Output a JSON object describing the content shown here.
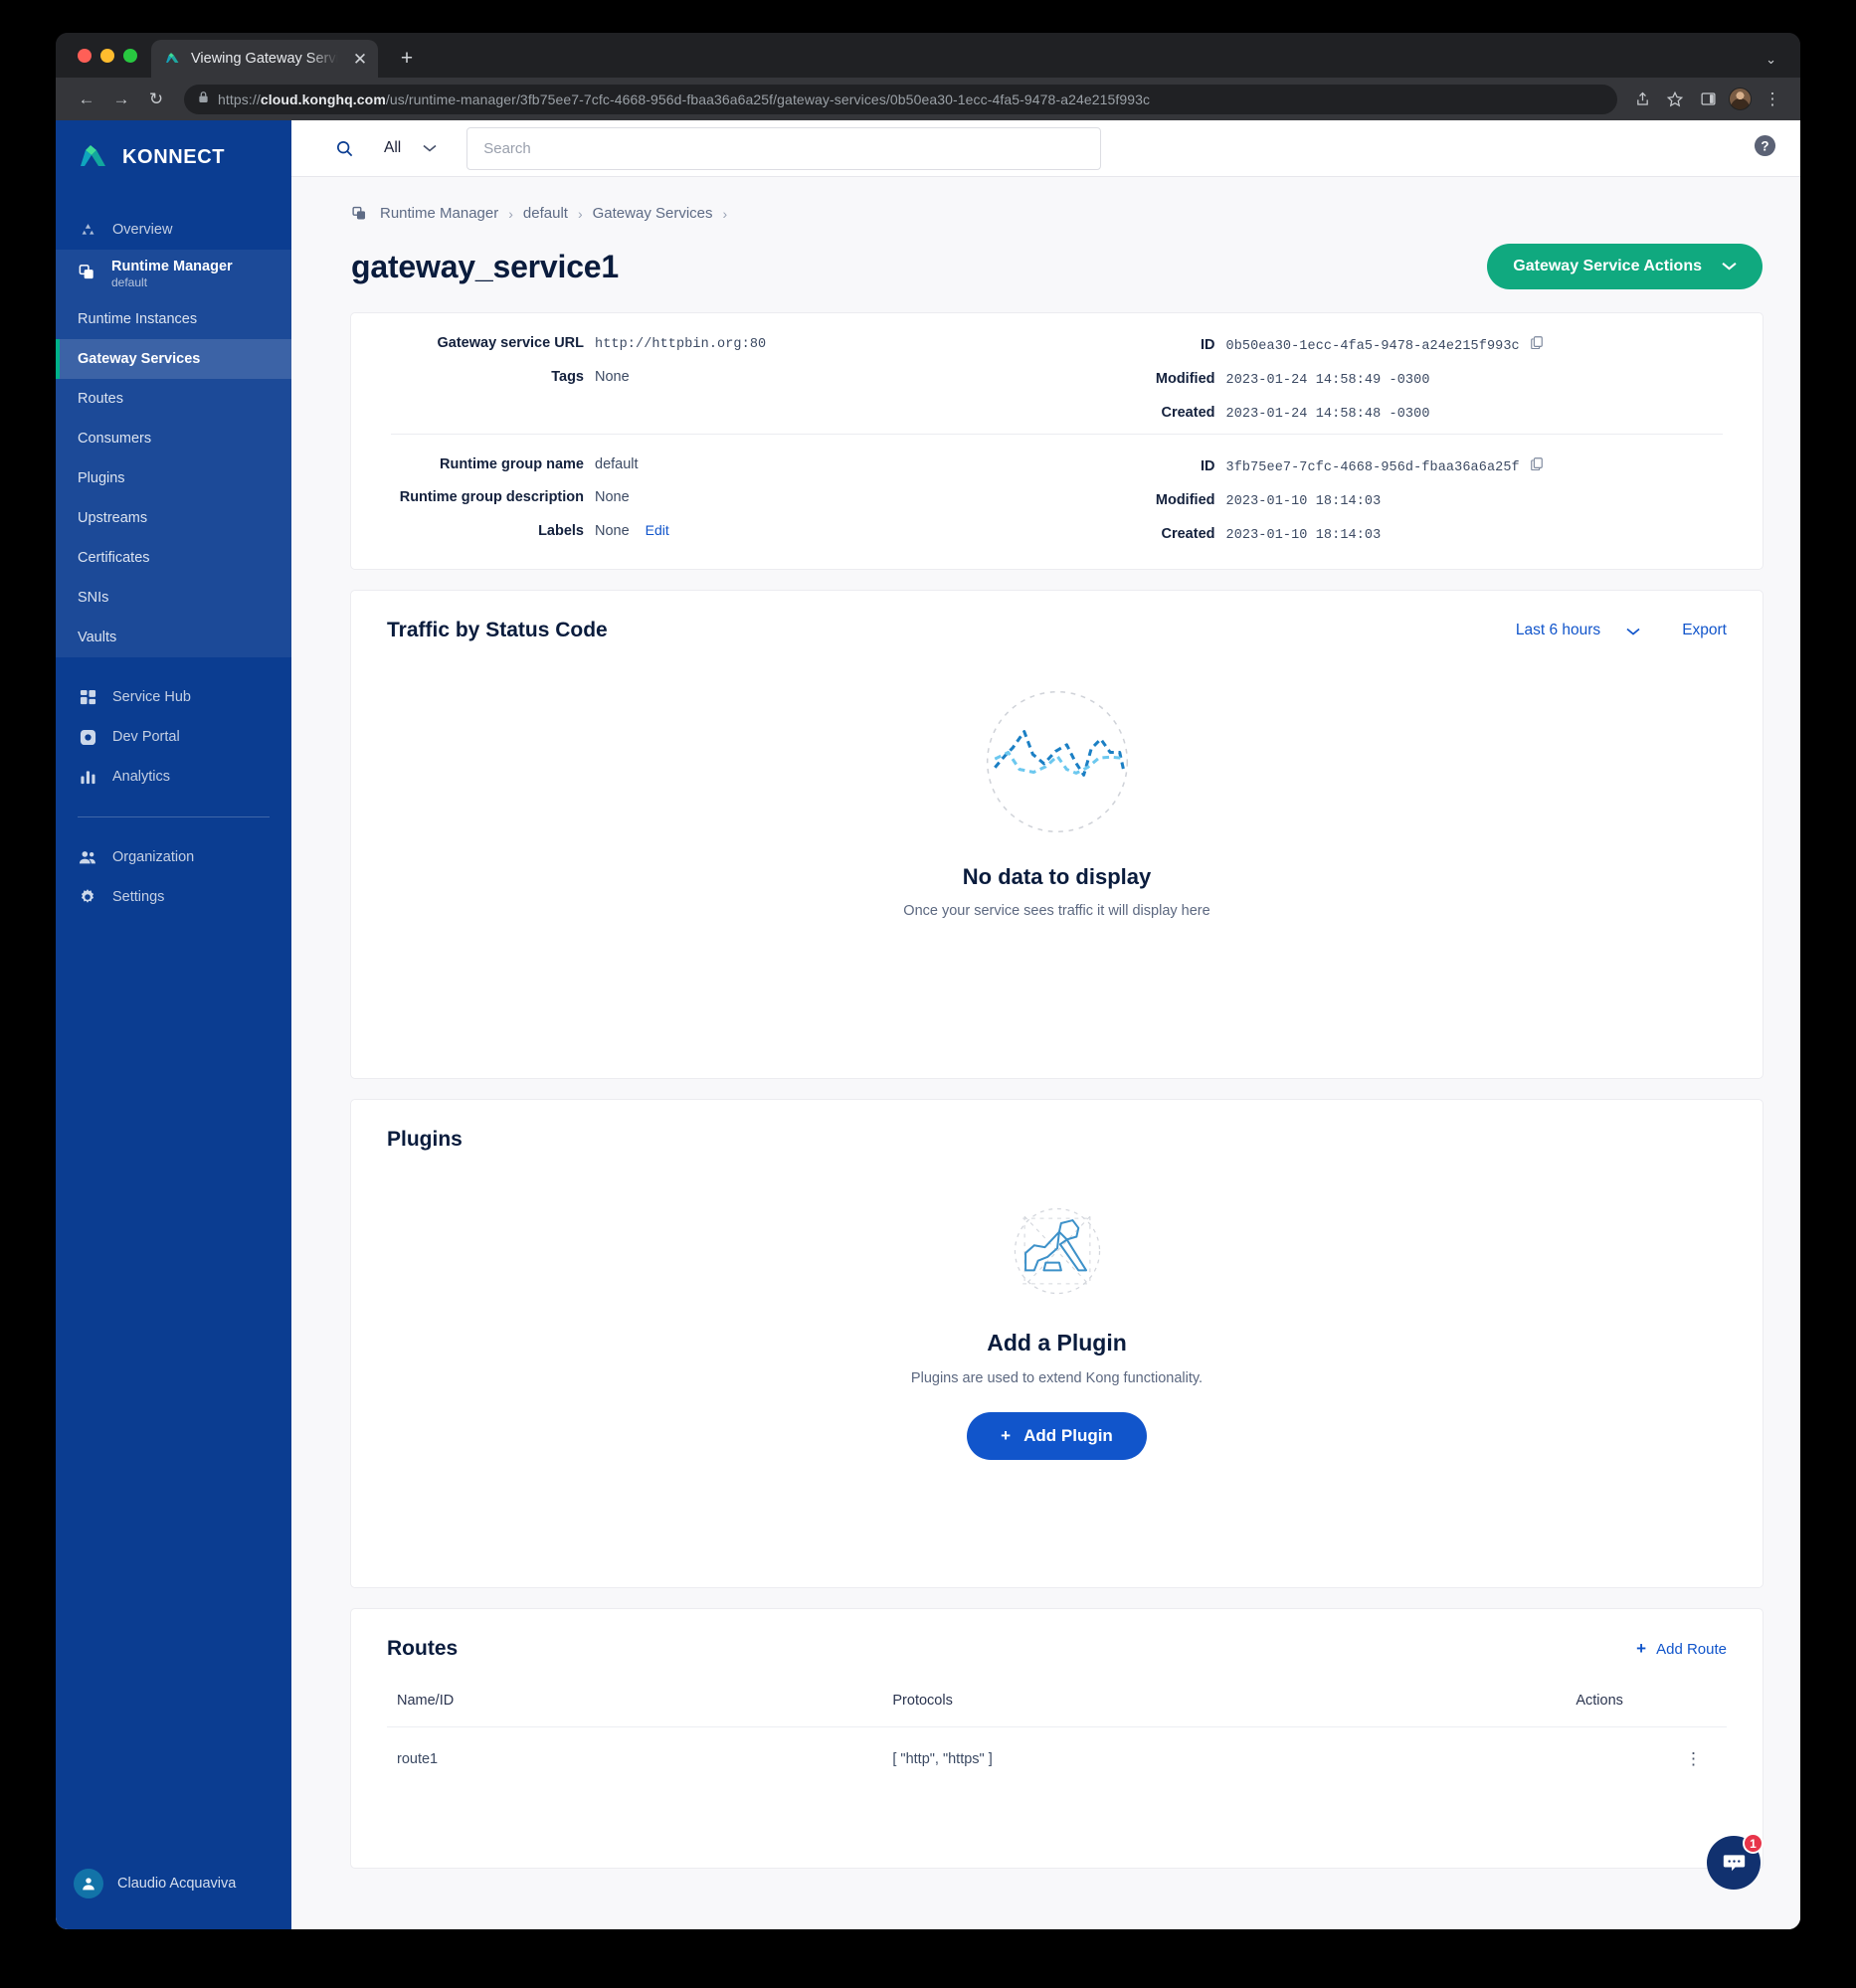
{
  "browser": {
    "tab_title": "Viewing Gateway Service | Kon",
    "tab_close_glyph": "✕",
    "new_tab_glyph": "+",
    "tabstrip_caret_glyph": "⌄",
    "back_glyph": "←",
    "forward_glyph": "→",
    "reload_glyph": "↻",
    "url_scheme": "https://",
    "url_host": "cloud.konghq.com",
    "url_path": "/us/runtime-manager/3fb75ee7-7cfc-4668-956d-fbaa36a6a25f/gateway-services/0b50ea30-1ecc-4fa5-9478-a24e215f993c",
    "menu_glyph": "⋮"
  },
  "sidebar": {
    "brand": "KONNECT",
    "overview_label": "Overview",
    "group": {
      "title": "Runtime Manager",
      "subtitle": "default"
    },
    "sub_items": [
      {
        "label": "Runtime Instances",
        "active": false
      },
      {
        "label": "Gateway Services",
        "active": true
      },
      {
        "label": "Routes",
        "active": false
      },
      {
        "label": "Consumers",
        "active": false
      },
      {
        "label": "Plugins",
        "active": false
      },
      {
        "label": "Upstreams",
        "active": false
      },
      {
        "label": "Certificates",
        "active": false
      },
      {
        "label": "SNIs",
        "active": false
      },
      {
        "label": "Vaults",
        "active": false
      }
    ],
    "apps": [
      {
        "label": "Service Hub",
        "icon": "grid-icon"
      },
      {
        "label": "Dev Portal",
        "icon": "portal-icon"
      },
      {
        "label": "Analytics",
        "icon": "bar-chart-icon"
      }
    ],
    "admin": [
      {
        "label": "Organization",
        "icon": "people-icon"
      },
      {
        "label": "Settings",
        "icon": "gear-icon"
      }
    ],
    "profile_name": "Claudio Acquaviva"
  },
  "topbar": {
    "scope_label": "All",
    "search_placeholder": "Search",
    "search_value": "",
    "help_label": "?"
  },
  "breadcrumb": [
    {
      "label": "Runtime Manager"
    },
    {
      "label": "default"
    },
    {
      "label": "Gateway Services"
    }
  ],
  "breadcrumb_separator": "›",
  "page": {
    "title": "gateway_service1",
    "actions_button": "Gateway Service Actions",
    "actions_caret": "⌄"
  },
  "service_info": {
    "left": [
      {
        "key": "Gateway service URL",
        "value": "http://httpbin.org:80",
        "mono": true
      },
      {
        "key": "Tags",
        "value": "None",
        "mono": false
      }
    ],
    "right": [
      {
        "key": "ID",
        "value": "0b50ea30-1ecc-4fa5-9478-a24e215f993c",
        "mono": true,
        "copy": true
      },
      {
        "key": "Modified",
        "value": "2023-01-24 14:58:49 -0300",
        "mono": true,
        "copy": false
      },
      {
        "key": "Created",
        "value": "2023-01-24 14:58:48 -0300",
        "mono": true,
        "copy": false
      }
    ]
  },
  "runtime_group_info": {
    "left": [
      {
        "key": "Runtime group name",
        "value": "default",
        "mono": false
      },
      {
        "key": "Runtime group description",
        "value": "None",
        "mono": false
      },
      {
        "key": "Labels",
        "value": "None",
        "mono": false,
        "edit": "Edit"
      }
    ],
    "right": [
      {
        "key": "ID",
        "value": "3fb75ee7-7cfc-4668-956d-fbaa36a6a25f",
        "mono": true,
        "copy": true
      },
      {
        "key": "Modified",
        "value": "2023-01-10 18:14:03",
        "mono": true,
        "copy": false
      },
      {
        "key": "Created",
        "value": "2023-01-10 18:14:03",
        "mono": true,
        "copy": false
      }
    ]
  },
  "traffic": {
    "title": "Traffic by Status Code",
    "timeframe": "Last 6 hours",
    "timeframe_caret": "⌄",
    "export_label": "Export",
    "empty_title": "No data to display",
    "empty_subtitle": "Once your service sees traffic it will display here"
  },
  "plugins": {
    "title": "Plugins",
    "empty_title": "Add a Plugin",
    "empty_subtitle": "Plugins are used to extend Kong functionality.",
    "add_button": "Add Plugin",
    "add_button_plus": "+"
  },
  "routes": {
    "title": "Routes",
    "add_label": "Add Route",
    "add_plus": "+",
    "columns": [
      "Name/ID",
      "Protocols",
      "Actions"
    ],
    "rows": [
      {
        "name": "route1",
        "protocols": "[ \"http\", \"https\" ]",
        "actions_glyph": "⋮"
      }
    ]
  },
  "chat": {
    "badge_count": "1"
  },
  "colors": {
    "sidebar_bg": "#0b3d91",
    "accent_green": "#10a97f",
    "accent_blue": "#1155cb",
    "active_marker": "#00b189",
    "badge_red": "#e8354a"
  }
}
